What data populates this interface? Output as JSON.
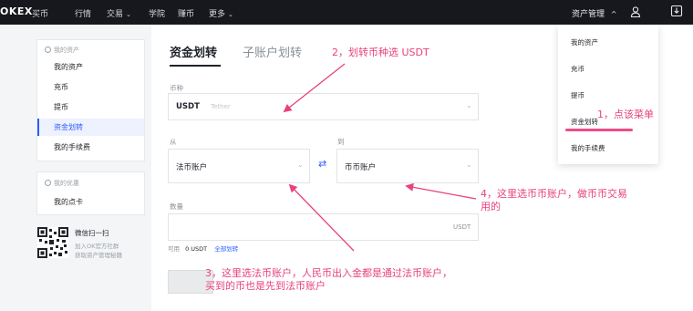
{
  "topbar": {
    "logo": "OKEX",
    "nav": [
      {
        "label": "买币",
        "caret": false
      },
      {
        "label": "行情",
        "caret": false
      },
      {
        "label": "交易",
        "caret": true
      },
      {
        "label": "学院",
        "caret": false
      },
      {
        "label": "赚币",
        "caret": false
      },
      {
        "label": "更多",
        "caret": true
      }
    ],
    "asset_menu": "资产管理",
    "caret_up": "^",
    "caret_down": "⌄"
  },
  "sidebar": {
    "assets_header": "我的资产",
    "items": [
      "我的资产",
      "充币",
      "提币",
      "资金划转",
      "我的手续费"
    ],
    "active_index": 3,
    "promo_header": "我的优惠",
    "promo_items": [
      "我的点卡"
    ],
    "wechat_title": "微信扫一扫",
    "wechat_line1": "加入OK官方社群",
    "wechat_line2": "获取资产管理秘籍"
  },
  "main": {
    "tabs": [
      "资金划转",
      "子账户划转"
    ],
    "coin_label": "币种",
    "coin_value": "USDT",
    "coin_sub": "Tether",
    "from_label": "从",
    "from_value": "法币账户",
    "to_label": "到",
    "to_value": "币币账户",
    "swap_symbol": "⇄",
    "amount_label": "数量",
    "amount_unit": "USDT",
    "available_label": "可用",
    "available_value": "0 USDT",
    "transfer_all": "全部划转"
  },
  "dropdown": {
    "items": [
      "我的资产",
      "充币",
      "提币",
      "资金划转",
      "我的手续费"
    ]
  },
  "annotations": {
    "a1": "1，点该菜单",
    "a2": "2，划转币种选 USDT",
    "a3_line1": "3，这里选法币账户，人民币出入金都是通过法币账户，",
    "a3_line2": "买到的币也是先到法币账户",
    "a4_line1": "4，这里选币币账户，做币币交易",
    "a4_line2": "用的"
  },
  "colors": {
    "accent": "#2c5cff",
    "annotation": "#e8417e",
    "topbar": "#16181d"
  }
}
